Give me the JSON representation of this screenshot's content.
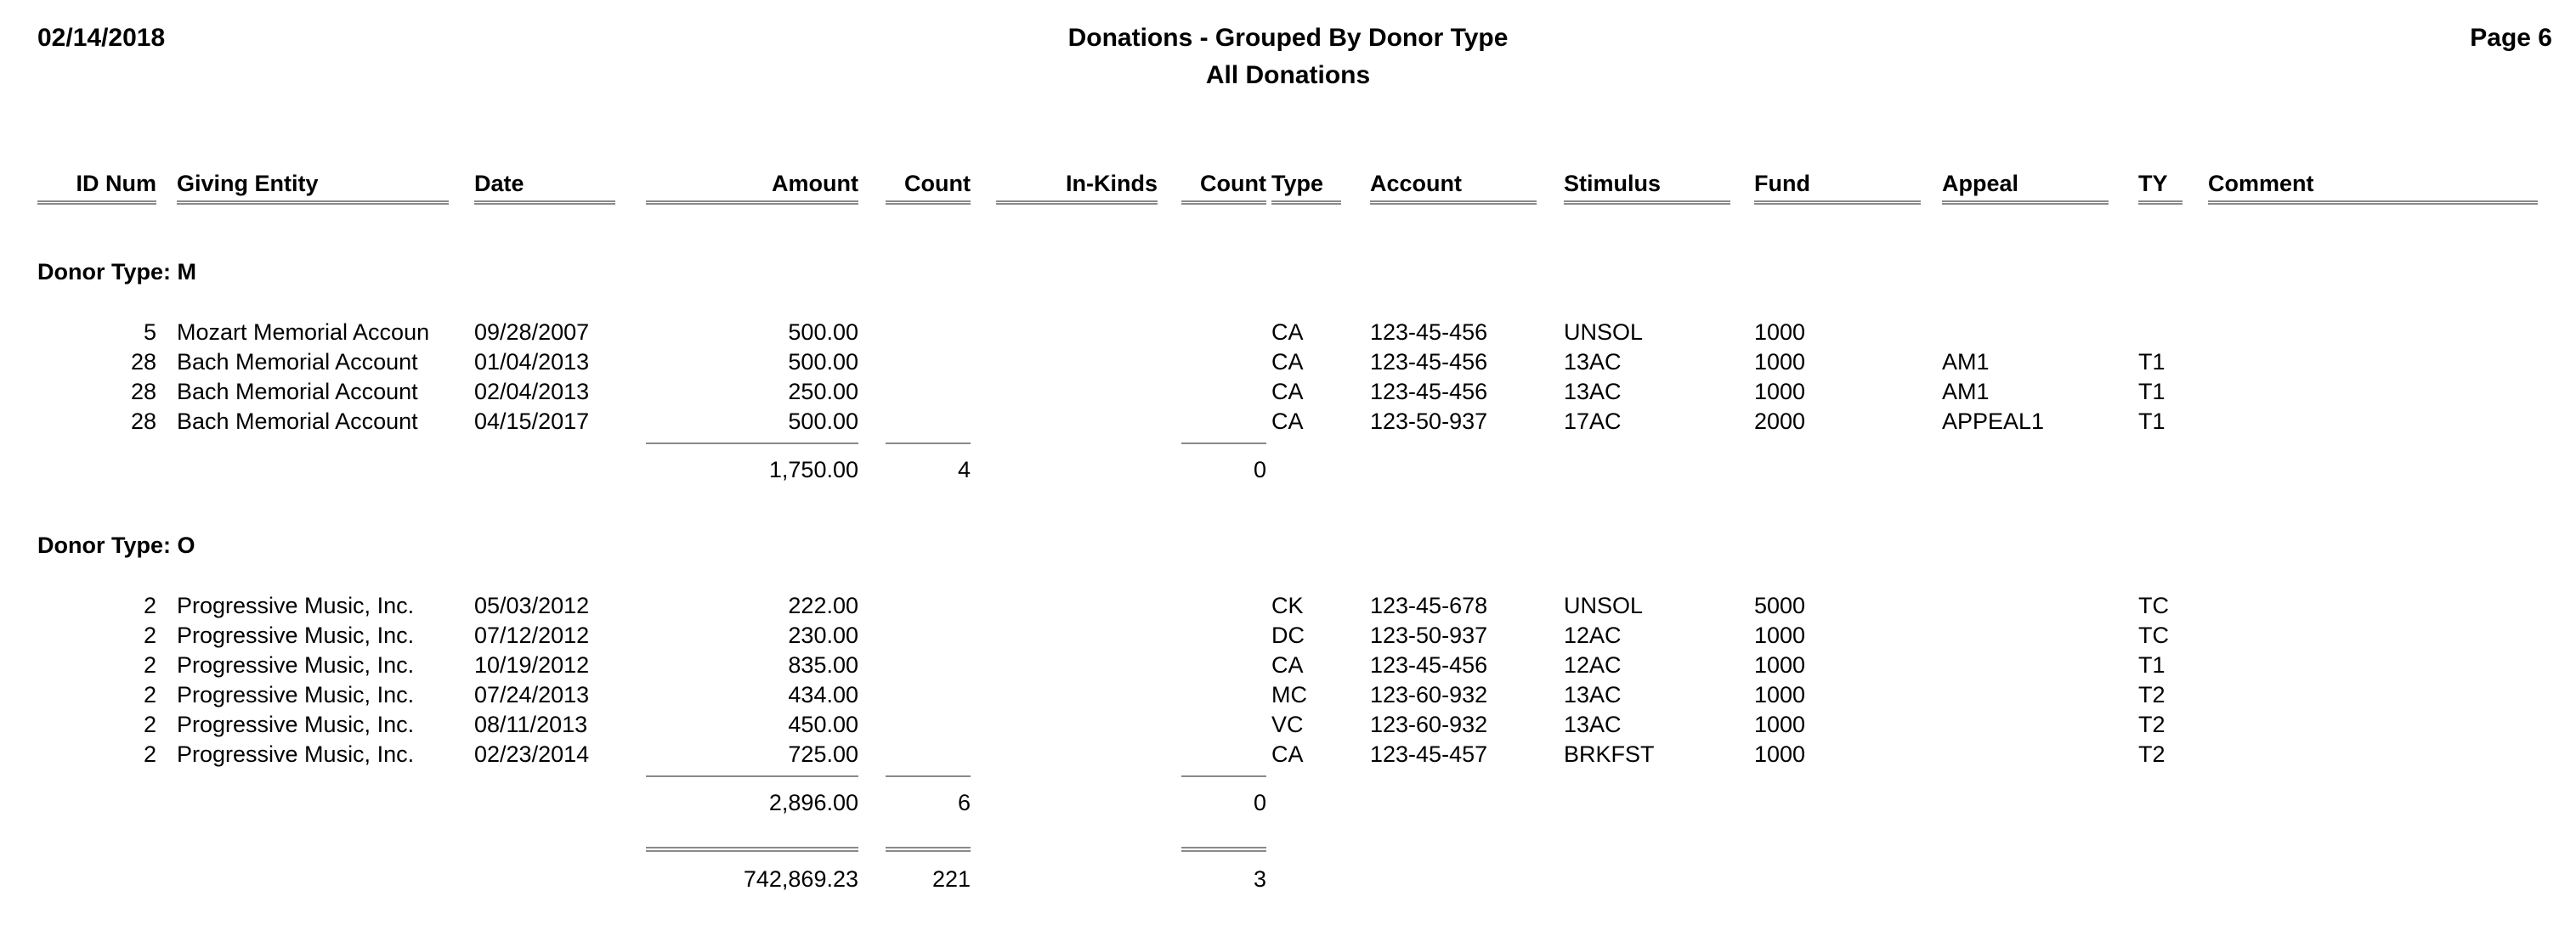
{
  "header": {
    "date": "02/14/2018",
    "title": "Donations - Grouped By Donor Type",
    "subtitle": "All Donations",
    "page_label": "Page 6"
  },
  "columns": {
    "id_num": "ID Num",
    "giving_entity": "Giving Entity",
    "date": "Date",
    "amount": "Amount",
    "count1": "Count",
    "in_kinds": "In-Kinds",
    "count2": "Count",
    "type": "Type",
    "account": "Account",
    "stimulus": "Stimulus",
    "fund": "Fund",
    "appeal": "Appeal",
    "ty": "TY",
    "comment": "Comment"
  },
  "groups": [
    {
      "label": "Donor Type: M",
      "rows": [
        {
          "id_num": "5",
          "giving_entity": "Mozart Memorial Accoun",
          "date": "09/28/2007",
          "amount": "500.00",
          "count1": "",
          "in_kinds": "",
          "count2": "",
          "type": "CA",
          "account": "123-45-456",
          "stimulus": "UNSOL",
          "fund": "1000",
          "appeal": "",
          "ty": "",
          "comment": ""
        },
        {
          "id_num": "28",
          "giving_entity": "Bach Memorial Account",
          "date": "01/04/2013",
          "amount": "500.00",
          "count1": "",
          "in_kinds": "",
          "count2": "",
          "type": "CA",
          "account": "123-45-456",
          "stimulus": "13AC",
          "fund": "1000",
          "appeal": "AM1",
          "ty": "T1",
          "comment": ""
        },
        {
          "id_num": "28",
          "giving_entity": "Bach Memorial Account",
          "date": "02/04/2013",
          "amount": "250.00",
          "count1": "",
          "in_kinds": "",
          "count2": "",
          "type": "CA",
          "account": "123-45-456",
          "stimulus": "13AC",
          "fund": "1000",
          "appeal": "AM1",
          "ty": "T1",
          "comment": ""
        },
        {
          "id_num": "28",
          "giving_entity": "Bach Memorial Account",
          "date": "04/15/2017",
          "amount": "500.00",
          "count1": "",
          "in_kinds": "",
          "count2": "",
          "type": "CA",
          "account": "123-50-937",
          "stimulus": "17AC",
          "fund": "2000",
          "appeal": "APPEAL1",
          "ty": "T1",
          "comment": ""
        }
      ],
      "subtotal": {
        "amount": "1,750.00",
        "count1": "4",
        "in_kinds": "",
        "count2": "0"
      }
    },
    {
      "label": "Donor Type: O",
      "rows": [
        {
          "id_num": "2",
          "giving_entity": "Progressive Music, Inc.",
          "date": "05/03/2012",
          "amount": "222.00",
          "count1": "",
          "in_kinds": "",
          "count2": "",
          "type": "CK",
          "account": "123-45-678",
          "stimulus": "UNSOL",
          "fund": "5000",
          "appeal": "",
          "ty": "TC",
          "comment": ""
        },
        {
          "id_num": "2",
          "giving_entity": "Progressive Music, Inc.",
          "date": "07/12/2012",
          "amount": "230.00",
          "count1": "",
          "in_kinds": "",
          "count2": "",
          "type": "DC",
          "account": "123-50-937",
          "stimulus": "12AC",
          "fund": "1000",
          "appeal": "",
          "ty": "TC",
          "comment": ""
        },
        {
          "id_num": "2",
          "giving_entity": "Progressive Music, Inc.",
          "date": "10/19/2012",
          "amount": "835.00",
          "count1": "",
          "in_kinds": "",
          "count2": "",
          "type": "CA",
          "account": "123-45-456",
          "stimulus": "12AC",
          "fund": "1000",
          "appeal": "",
          "ty": "T1",
          "comment": ""
        },
        {
          "id_num": "2",
          "giving_entity": "Progressive Music, Inc.",
          "date": "07/24/2013",
          "amount": "434.00",
          "count1": "",
          "in_kinds": "",
          "count2": "",
          "type": "MC",
          "account": "123-60-932",
          "stimulus": "13AC",
          "fund": "1000",
          "appeal": "",
          "ty": "T2",
          "comment": ""
        },
        {
          "id_num": "2",
          "giving_entity": "Progressive Music, Inc.",
          "date": "08/11/2013",
          "amount": "450.00",
          "count1": "",
          "in_kinds": "",
          "count2": "",
          "type": "VC",
          "account": "123-60-932",
          "stimulus": "13AC",
          "fund": "1000",
          "appeal": "",
          "ty": "T2",
          "comment": ""
        },
        {
          "id_num": "2",
          "giving_entity": "Progressive Music, Inc.",
          "date": "02/23/2014",
          "amount": "725.00",
          "count1": "",
          "in_kinds": "",
          "count2": "",
          "type": "CA",
          "account": "123-45-457",
          "stimulus": "BRKFST",
          "fund": "1000",
          "appeal": "",
          "ty": "T2",
          "comment": ""
        }
      ],
      "subtotal": {
        "amount": "2,896.00",
        "count1": "6",
        "in_kinds": "",
        "count2": "0"
      }
    }
  ],
  "grand_total": {
    "amount": "742,869.23",
    "count1": "221",
    "in_kinds": "",
    "count2": "3"
  }
}
